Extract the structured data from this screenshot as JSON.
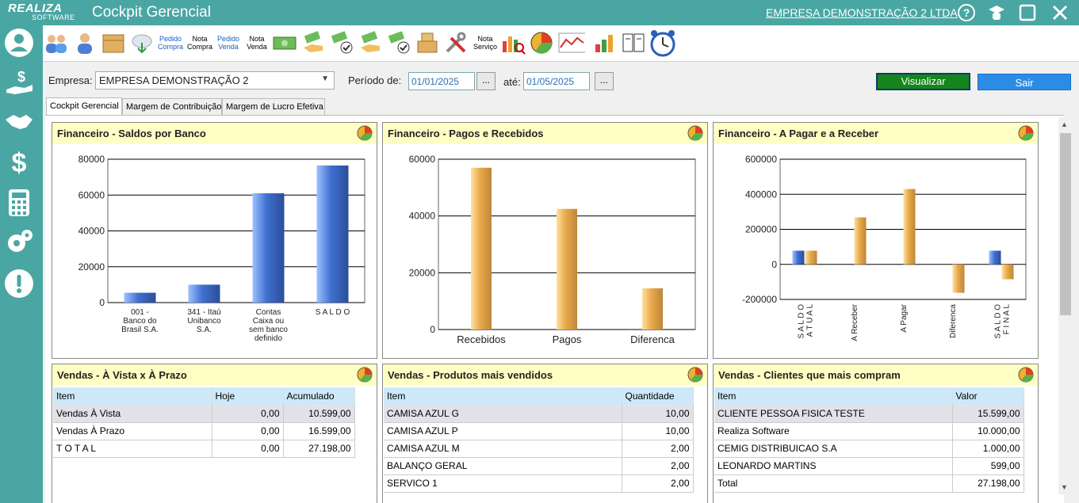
{
  "app": {
    "logo_line1": "REALIZA",
    "logo_line2": "SOFTWARE",
    "title": "Cockpit Gerencial",
    "company_link": "EMPRESA DEMONSTRAÇÃO 2 LTDA"
  },
  "toolbar": {
    "pedido_compra": [
      "Pedido",
      "Compra"
    ],
    "nota_compra": [
      "Nota",
      "Compra"
    ],
    "pedido_venda": [
      "Pedido",
      "Venda"
    ],
    "nota_venda": [
      "Nota",
      "Venda"
    ],
    "nota_servico": [
      "Nota",
      "Serviço"
    ]
  },
  "filters": {
    "empresa_label": "Empresa:",
    "empresa_value": "EMPRESA DEMONSTRAÇÃO 2",
    "periodo_label": "Período de:",
    "date_from": "01/01/2025",
    "ate_label": "até:",
    "date_to": "01/05/2025",
    "dots": "...",
    "visualizar": "Visualizar",
    "sair": "Sair"
  },
  "tabs": [
    "Cockpit Gerencial",
    "Margem de Contribuição",
    "Margem de Lucro Efetiva"
  ],
  "panels": {
    "saldos_banco": "Financeiro - Saldos por Banco",
    "pagos_recebidos": "Financeiro - Pagos e Recebidos",
    "pagar_receber": "Financeiro - A Pagar e a Receber",
    "vista_prazo": "Vendas - À Vista x À Prazo",
    "produtos": "Vendas - Produtos mais vendidos",
    "clientes": "Vendas - Clientes que mais compram"
  },
  "chart_data": [
    {
      "type": "bar",
      "title": "Financeiro - Saldos por Banco",
      "categories": [
        [
          "001 -",
          "Banco do",
          "Brasil S.A."
        ],
        [
          "341 - Itaú",
          "Unibanco",
          "S.A."
        ],
        [
          "Contas",
          "Caixa ou",
          "sem banco",
          "definido"
        ],
        [
          "S A L D O"
        ]
      ],
      "values": [
        5500,
        10000,
        61000,
        76500
      ],
      "ylim": [
        0,
        80000
      ],
      "yticks": [
        0,
        20000,
        40000,
        60000,
        80000
      ],
      "grid": true,
      "colors": [
        "#3f6fd0"
      ]
    },
    {
      "type": "bar",
      "title": "Financeiro - Pagos e Recebidos",
      "categories": [
        "Recebidos",
        "Pagos",
        "Diferenca"
      ],
      "values": [
        57000,
        42500,
        14500
      ],
      "ylim": [
        0,
        60000
      ],
      "yticks": [
        0,
        20000,
        40000,
        60000
      ],
      "grid": true,
      "colors": [
        "#e8a94a"
      ]
    },
    {
      "type": "bar",
      "title": "Financeiro - A Pagar e a Receber",
      "categories": [
        [
          "S A L D O",
          "A T U A L"
        ],
        [
          "A Receber"
        ],
        [
          "A Pagar"
        ],
        [
          "Diferenca"
        ],
        [
          "S A L D O",
          "F I N A L"
        ]
      ],
      "series": [
        {
          "values": [
            78000,
            null,
            null,
            null,
            78000
          ]
        },
        {
          "values": [
            78000,
            268000,
            430000,
            -162000,
            -85000
          ]
        }
      ],
      "ylim": [
        -200000,
        600000
      ],
      "yticks": [
        -200000,
        0,
        200000,
        400000,
        600000
      ],
      "grid": true,
      "colors": [
        "#3f6fd0",
        "#e8a94a"
      ]
    }
  ],
  "tables": {
    "vista_prazo": {
      "headers": [
        "Item",
        "Hoje",
        "Acumulado"
      ],
      "rows": [
        [
          "Vendas À Vista",
          "0,00",
          "10.599,00"
        ],
        [
          "Vendas À Prazo",
          "0,00",
          "16.599,00"
        ],
        [
          "T O T A L",
          "0,00",
          "27.198,00"
        ]
      ]
    },
    "produtos": {
      "headers": [
        "Item",
        "Quantidade"
      ],
      "rows": [
        [
          "CAMISA AZUL G",
          "10,00"
        ],
        [
          "CAMISA AZUL P",
          "10,00"
        ],
        [
          "CAMISA AZUL M",
          "2,00"
        ],
        [
          "BALANÇO GERAL",
          "2,00"
        ],
        [
          "SERVICO 1",
          "2,00"
        ]
      ]
    },
    "clientes": {
      "headers": [
        "Item",
        "Valor"
      ],
      "rows": [
        [
          "CLIENTE PESSOA FISICA TESTE",
          "15.599,00"
        ],
        [
          "Realiza Software",
          "10.000,00"
        ],
        [
          "CEMIG DISTRIBUICAO S.A",
          "1.000,00"
        ],
        [
          "LEONARDO MARTINS",
          "599,00"
        ],
        [
          "Total",
          "27.198,00"
        ]
      ]
    }
  },
  "icons": [
    "help-icon",
    "graduation-icon",
    "maximize-icon",
    "close-icon",
    "user-icon",
    "hand-money-icon",
    "handshake-icon",
    "dollar-icon",
    "calculator-icon",
    "gears-icon",
    "alert-icon"
  ]
}
